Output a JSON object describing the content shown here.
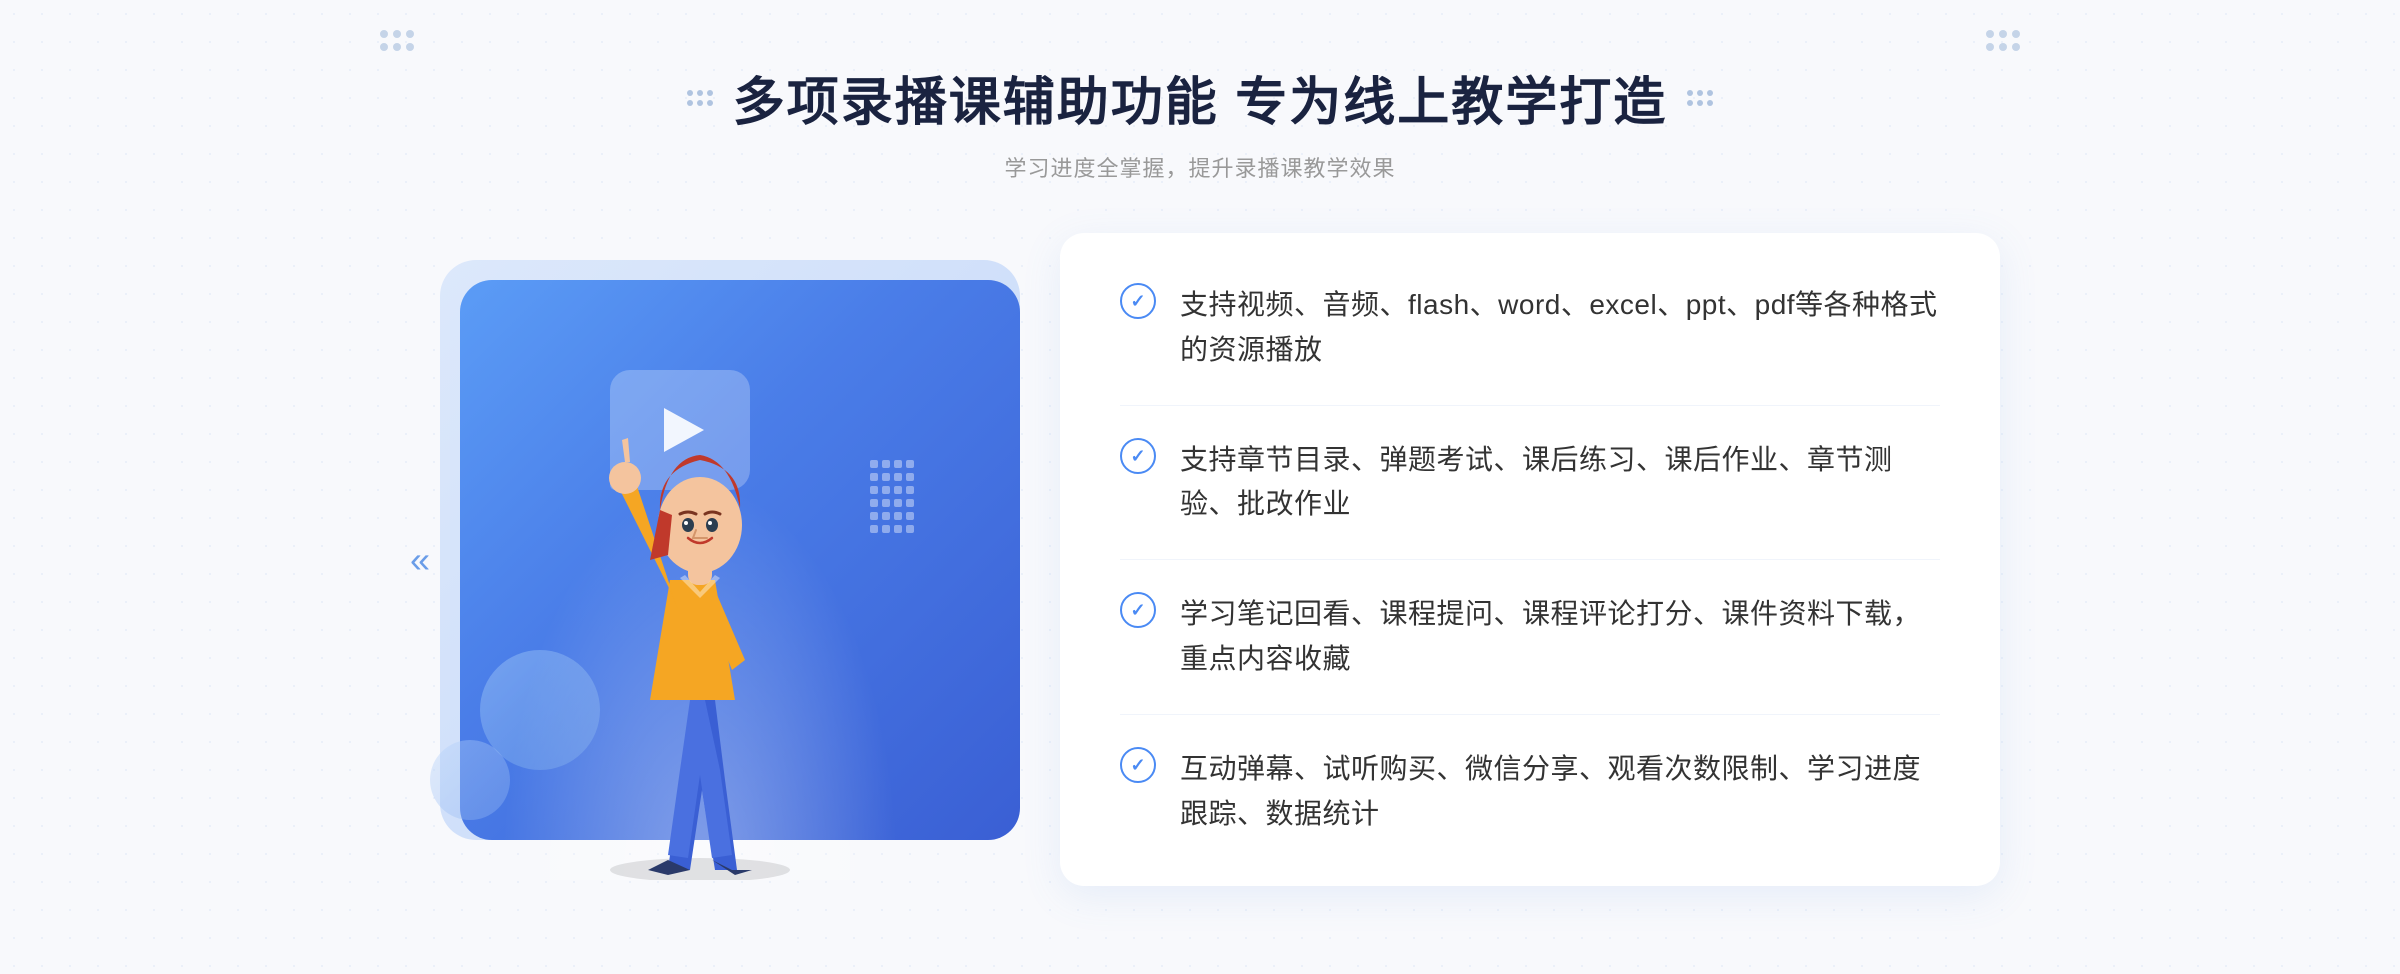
{
  "header": {
    "title": "多项录播课辅助功能 专为线上教学打造",
    "subtitle": "学习进度全掌握，提升录播课教学效果"
  },
  "features": [
    {
      "id": 1,
      "text": "支持视频、音频、flash、word、excel、ppt、pdf等各种格式的资源播放"
    },
    {
      "id": 2,
      "text": "支持章节目录、弹题考试、课后练习、课后作业、章节测验、批改作业"
    },
    {
      "id": 3,
      "text": "学习笔记回看、课程提问、课程评论打分、课件资料下载，重点内容收藏"
    },
    {
      "id": 4,
      "text": "互动弹幕、试听购买、微信分享、观看次数限制、学习进度跟踪、数据统计"
    }
  ],
  "decoration": {
    "chevrons": "»",
    "chevrons_left": "«"
  }
}
